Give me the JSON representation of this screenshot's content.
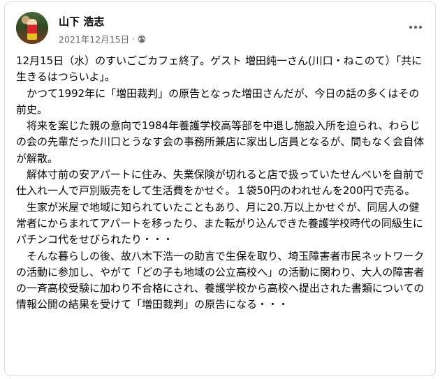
{
  "post": {
    "author_name": "山下 浩志",
    "date": "2021年12月15日",
    "separator": "·",
    "privacy_icon": "globe-icon",
    "more_icon": "more-horizontal-icon",
    "paragraphs": [
      "12月15日（水）のすいごごカフェ終了。ゲスト 増田純一さん(川口・ねこのて）「共に生きるはつらいよ」。",
      "　かつて1992年に「増田裁判」の原告となった増田さんだが、今日の話の多くはその前史。",
      "　将来を案じた親の意向で1984年養護学校高等部を中退し施設入所を迫られ、わらじの会の先輩だった川口とうなす会の事務所兼店に家出し店員となるが、間もなく会自体が解散。",
      "　解体寸前の安アパートに住み、失業保険が切れると店で扱っていたせんべいを自前で仕入れ一人で戸別販売をして生活費をかせぐ。１袋50円のわれせんを200円で売る。",
      "　生家が米屋で地域に知られていたこともあり、月に20.万以上かせぐが、同居人の健常者にからまれてアパートを移ったり、また転がり込んできた養護学校時代の同級生にパチンコ代をせびられたり・・・",
      "　そんな暮らしの後、故八木下浩一の助言で生保を取り、埼玉障害者市民ネットワークの活動に参加し、やがて「どの子も地域の公立高校へ」の活動に関わり、大人の障害者の一斉高校受験に加わり不合格にされ、養護学校から高校へ提出された書類についての情報公開の結果を受けて「増田裁判」の原告になる・・・"
    ]
  },
  "colors": {
    "text_primary": "#050505",
    "text_secondary": "#65676b",
    "border": "#dadde1",
    "background": "#ffffff"
  }
}
